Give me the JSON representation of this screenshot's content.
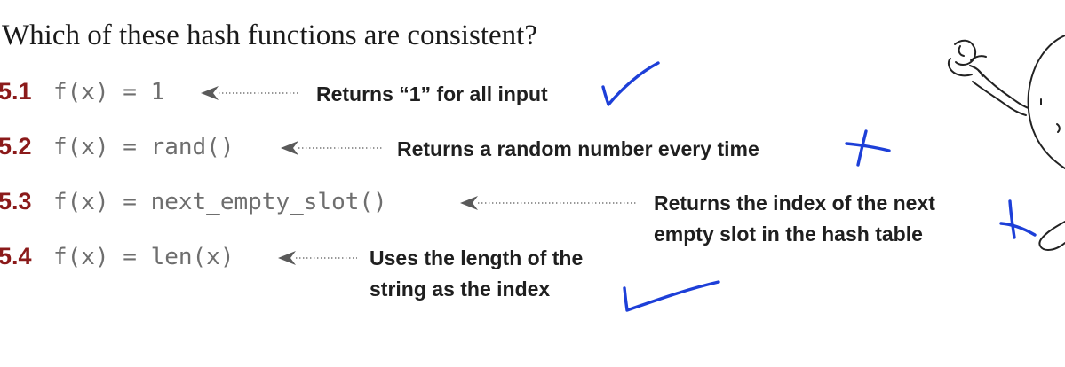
{
  "question": "Which of these hash functions are consistent?",
  "items": [
    {
      "number": "5.1",
      "code": "f(x) = 1",
      "note_lines": [
        "Returns “1” for all input"
      ],
      "mark": "check"
    },
    {
      "number": "5.2",
      "code": "f(x) = rand()",
      "note_lines": [
        "Returns a random number every time"
      ],
      "mark": "cross"
    },
    {
      "number": "5.3",
      "code": "f(x) = next_empty_slot()",
      "note_lines": [
        "Returns the index of the next",
        "empty slot in the hash table"
      ],
      "mark": "cross"
    },
    {
      "number": "5.4",
      "code": "f(x) = len(x)",
      "note_lines": [
        "Uses the length of the",
        "string as the index"
      ],
      "mark": "check"
    }
  ],
  "colors": {
    "number": "#8b1a1a",
    "code": "#6e6e6e",
    "ink_marks": "#1d3fd8"
  },
  "icons": [
    "arrow-left-icon",
    "check-mark-icon",
    "cross-mark-icon",
    "cartoon-character-icon"
  ]
}
